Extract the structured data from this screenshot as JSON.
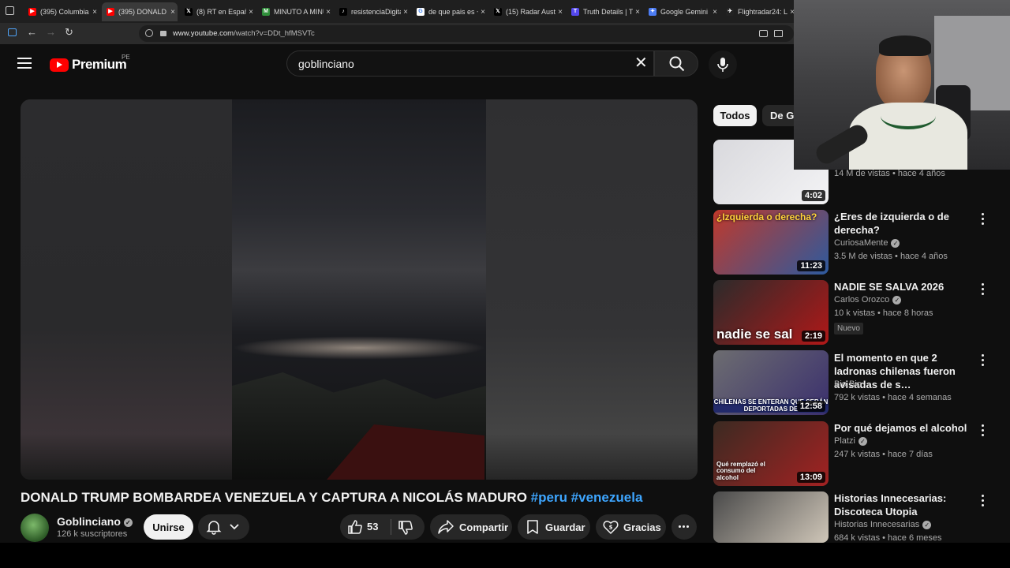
{
  "browser": {
    "tabs": [
      {
        "title": "(395) Columbia \\",
        "fav": "yt",
        "active": false
      },
      {
        "title": "(395) DONALD T",
        "fav": "yt",
        "active": true
      },
      {
        "title": "(8) RT en Españo",
        "fav": "x",
        "active": false
      },
      {
        "title": "MINUTO A MINU",
        "fav": "mm",
        "active": false
      },
      {
        "title": "resistenciaDigital",
        "fav": "tiktok",
        "active": false
      },
      {
        "title": "de que pais es +",
        "fav": "google",
        "active": false
      },
      {
        "title": "(15) Radar Austra",
        "fav": "x",
        "active": false
      },
      {
        "title": "Truth Details | Tr",
        "fav": "truth",
        "active": false
      },
      {
        "title": "Google Gemini",
        "fav": "gemini",
        "active": false
      },
      {
        "title": "Flightradar24: Liv",
        "fav": "fr24",
        "active": false
      }
    ],
    "url_domain": "www.youtube.com",
    "url_path": "/watch?v=DDt_hfMSVTc"
  },
  "masthead": {
    "logo_text": "Premium",
    "region": "PE",
    "search_value": "goblinciano"
  },
  "video": {
    "title": "DONALD TRUMP BOMBARDEA VENEZUELA Y CAPTURA A NICOLÁS MADURO",
    "hashtags": "#peru #venezuela",
    "channel": "Goblinciano",
    "subscribers": "126 k suscriptores",
    "join_label": "Unirse",
    "likes": "53",
    "share_label": "Compartir",
    "save_label": "Guardar",
    "thanks_label": "Gracias"
  },
  "chips": [
    "Todos",
    "De Go"
  ],
  "recommendations": [
    {
      "title": "",
      "channel": "",
      "meta": "14 M de vistas • hace 4 años",
      "duration": "4:02",
      "thumb_text": "",
      "colors": [
        "#d9d9dd",
        "#f3f3f5"
      ],
      "new": false
    },
    {
      "title": "¿Eres de izquierda o de derecha?",
      "channel": "CuriosaMente",
      "verified": true,
      "meta": "3.5 M de vistas • hace 4 años",
      "duration": "11:23",
      "thumb_text": "¿Izquierda o derecha?",
      "colors": [
        "#c0392b",
        "#2d5a9e"
      ],
      "new": false
    },
    {
      "title": "NADIE SE SALVA 2026",
      "channel": "Carlos Orozco",
      "verified": true,
      "meta": "10 k vistas • hace 8 horas",
      "duration": "2:19",
      "thumb_text": "nadie se sal",
      "colors": [
        "#2b2b2b",
        "#b01818"
      ],
      "new": true,
      "new_label": "Nuevo"
    },
    {
      "title": "El momento en que 2 ladronas chilenas fueron avisadas de s…",
      "channel": "Bio Bio",
      "verified": false,
      "meta": "792 k vistas • hace 4 semanas",
      "duration": "12:58",
      "thumb_text": "CHILENAS SE ENTERAN QUE SERÁN DEPORTADAS DE",
      "colors": [
        "#6d6d70",
        "#3a2f6e"
      ],
      "new": false
    },
    {
      "title": "Por qué dejamos el alcohol",
      "channel": "Platzi",
      "verified": true,
      "meta": "247 k vistas • hace 7 días",
      "duration": "13:09",
      "thumb_text": "Qué remplazó el consumo del alcohol",
      "colors": [
        "#3b2a22",
        "#a32222"
      ],
      "new": false
    },
    {
      "title": "Historias Innecesarias: Discoteca Utopia",
      "channel": "Historias Innecesarias",
      "verified": true,
      "meta": "684 k vistas • hace 6 meses",
      "duration": "",
      "thumb_text": "",
      "colors": [
        "#4a4a4a",
        "#cfc6b8"
      ],
      "new": false
    }
  ],
  "colors": {
    "background": "#0f0f0f",
    "accent": "#ff0000",
    "link": "#3ea6ff"
  }
}
